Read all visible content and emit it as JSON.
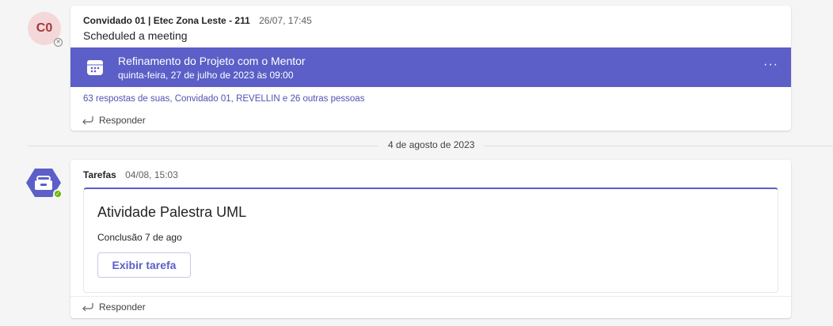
{
  "message1": {
    "avatar_initials": "C0",
    "author": "Convidado 01 | Etec Zona Leste - 211",
    "time": "26/07, 17:45",
    "body": "Scheduled a meeting",
    "meeting": {
      "icon": "calendar-icon",
      "title": "Refinamento do Projeto com o Mentor",
      "date": "quinta-feira, 27 de julho de 2023 às 09:00",
      "more_label": "···"
    },
    "replies_text": "63 respostas de suas, Convidado 01, REVELLIN e 26 outras pessoas",
    "reply_label": "Responder"
  },
  "date_divider": "4 de agosto de 2023",
  "message2": {
    "avatar_icon": "tasks-app-icon",
    "author": "Tarefas",
    "time": "04/08, 15:03",
    "task": {
      "title": "Atividade Palestra UML",
      "due": "Conclusão 7 de ago",
      "button_label": "Exibir tarefa"
    },
    "reply_label": "Responder"
  },
  "colors": {
    "accent": "#5b5fc7",
    "avatar_bg": "#f4d8d9",
    "avatar_fg": "#a4373a",
    "presence_available": "#6bb700"
  }
}
